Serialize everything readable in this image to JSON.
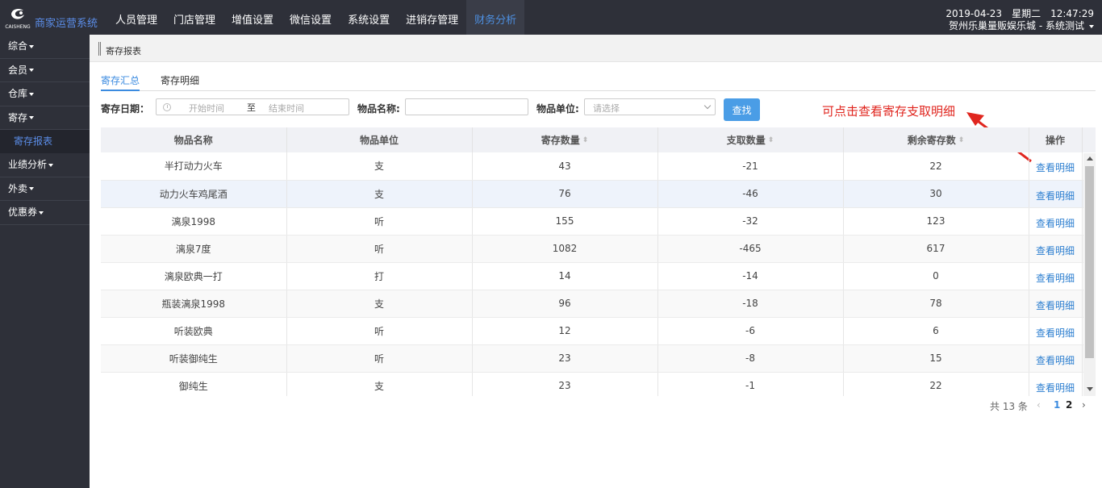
{
  "app": {
    "logo_text": "CAISHENG",
    "brand": "商家运营系统"
  },
  "nav": {
    "items": [
      "人员管理",
      "门店管理",
      "增值设置",
      "微信设置",
      "系统设置",
      "进销存管理",
      "财务分析"
    ],
    "active": "财务分析"
  },
  "header": {
    "date": "2019-04-23",
    "weekday": "星期二",
    "time": "12:47:29",
    "store": "贺州乐巢量贩娱乐城 - 系统测试"
  },
  "sidebar": {
    "items": [
      "综合",
      "会员",
      "仓库",
      "寄存",
      "寄存报表",
      "业绩分析",
      "外卖",
      "优惠券"
    ],
    "active_sub": "寄存报表"
  },
  "breadcrumb": "寄存报表",
  "tabs": {
    "summary": "寄存汇总",
    "detail": "寄存明细",
    "active": "寄存汇总"
  },
  "filters": {
    "date_label": "寄存日期：",
    "start_placeholder": "开始时间",
    "separator": "至",
    "end_placeholder": "结束时间",
    "name_label": "物品名称:",
    "name_value": "",
    "unit_label": "物品单位:",
    "unit_placeholder": "请选择",
    "search_label": "查找"
  },
  "annotation": "可点击查看寄存支取明细",
  "colors": {
    "accent": "#3b8be0",
    "annotation": "#e0261f",
    "topbar": "#2e3039",
    "button": "#4a9de6"
  },
  "table": {
    "columns": [
      "物品名称",
      "物品单位",
      "寄存数量",
      "支取数量",
      "剩余寄存数",
      "操作"
    ],
    "rows": [
      {
        "name": "半打动力火车",
        "unit": "支",
        "stored": "43",
        "withdrawn": "-21",
        "remaining": "22",
        "op": "查看明细"
      },
      {
        "name": "动力火车鸡尾酒",
        "unit": "支",
        "stored": "76",
        "withdrawn": "-46",
        "remaining": "30",
        "op": "查看明细"
      },
      {
        "name": "漓泉1998",
        "unit": "听",
        "stored": "155",
        "withdrawn": "-32",
        "remaining": "123",
        "op": "查看明细"
      },
      {
        "name": "漓泉7度",
        "unit": "听",
        "stored": "1082",
        "withdrawn": "-465",
        "remaining": "617",
        "op": "查看明细"
      },
      {
        "name": "漓泉欧典一打",
        "unit": "打",
        "stored": "14",
        "withdrawn": "-14",
        "remaining": "0",
        "op": "查看明细"
      },
      {
        "name": "瓶装漓泉1998",
        "unit": "支",
        "stored": "96",
        "withdrawn": "-18",
        "remaining": "78",
        "op": "查看明细"
      },
      {
        "name": "听装欧典",
        "unit": "听",
        "stored": "12",
        "withdrawn": "-6",
        "remaining": "6",
        "op": "查看明细"
      },
      {
        "name": "听装御纯生",
        "unit": "听",
        "stored": "23",
        "withdrawn": "-8",
        "remaining": "15",
        "op": "查看明细"
      },
      {
        "name": "御纯生",
        "unit": "支",
        "stored": "23",
        "withdrawn": "-1",
        "remaining": "22",
        "op": "查看明细"
      }
    ]
  },
  "pagination": {
    "total": "共 13 条",
    "pages": [
      "1",
      "2"
    ],
    "current": "1",
    "prev": "‹",
    "next": "›"
  }
}
